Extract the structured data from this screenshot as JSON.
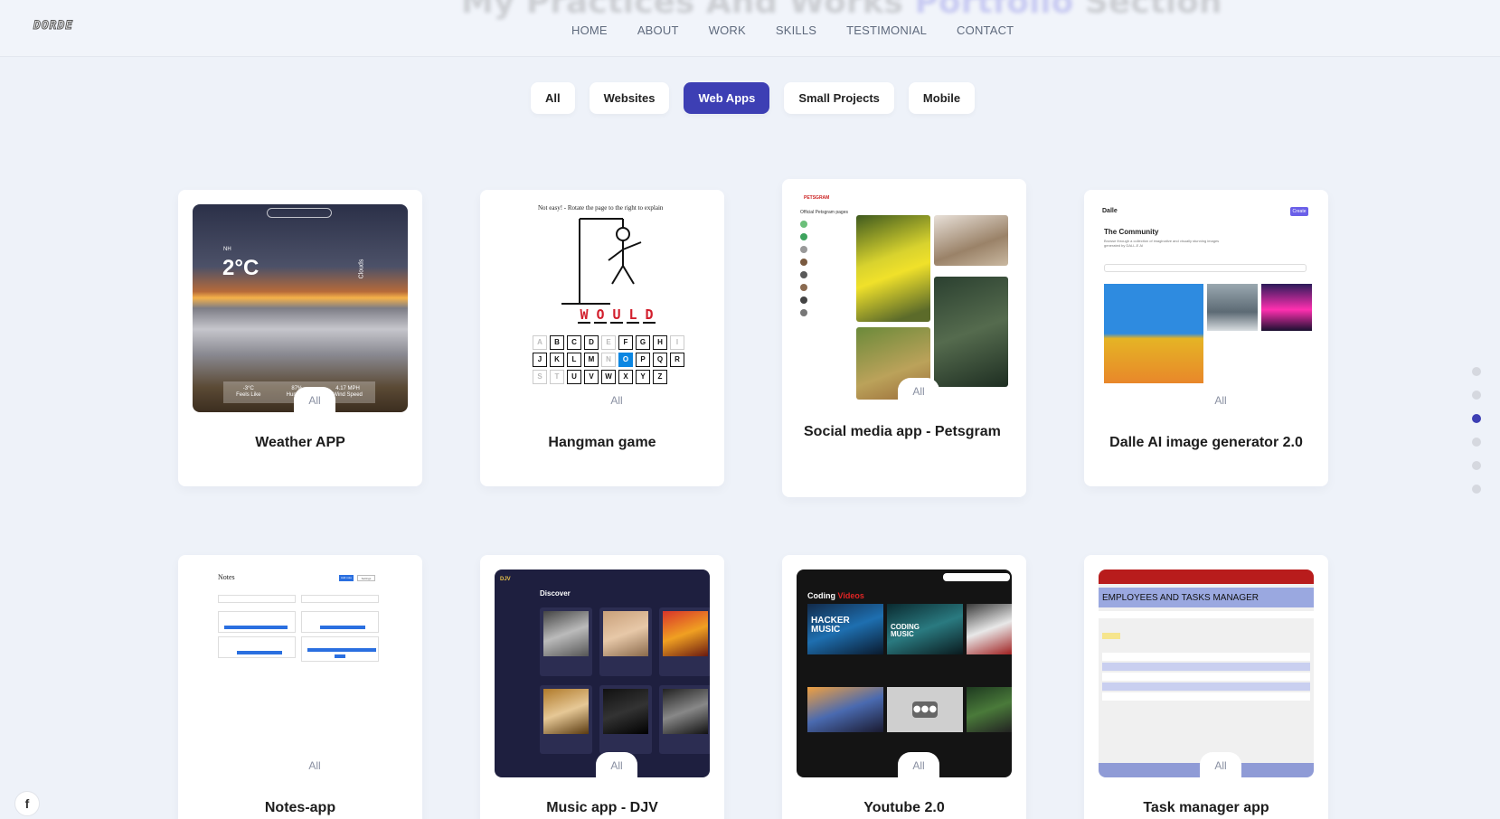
{
  "header": {
    "logo": "DORDE",
    "ghost_prefix": "My Practices And Works ",
    "ghost_accent": "Portfolio",
    "ghost_suffix": " Section",
    "nav": [
      "HOME",
      "ABOUT",
      "WORK",
      "SKILLS",
      "TESTIMONIAL",
      "CONTACT"
    ]
  },
  "filters": [
    {
      "label": "All",
      "active": false
    },
    {
      "label": "Websites",
      "active": false
    },
    {
      "label": "Web Apps",
      "active": true
    },
    {
      "label": "Small Projects",
      "active": false
    },
    {
      "label": "Mobile",
      "active": false
    }
  ],
  "projects": [
    {
      "title": "Weather APP",
      "tag": "All"
    },
    {
      "title": "Hangman game",
      "tag": "All"
    },
    {
      "title": "Social media app - Petsgram",
      "tag": "All"
    },
    {
      "title": "Dalle AI image generator 2.0",
      "tag": "All"
    },
    {
      "title": "Notes-app",
      "tag": "All"
    },
    {
      "title": "Music app - DJV",
      "tag": "All"
    },
    {
      "title": "Youtube 2.0",
      "tag": "All"
    },
    {
      "title": "Task manager app",
      "tag": "All"
    }
  ],
  "weather": {
    "city": "NH",
    "temp": "2°C",
    "condition": "Clouds",
    "feels_value": "-3°C",
    "feels_label": "Feels Like",
    "humidity_value": "87%",
    "humidity_label": "Humidity",
    "wind_value": "4.17 MPH",
    "wind_label": "Wind Speed"
  },
  "hangman": {
    "hint": "Not easy! - Rotate the page to the right to explain",
    "word": [
      "W",
      "O",
      "U",
      "L",
      "D"
    ],
    "rows": [
      [
        "A",
        "B",
        "C",
        "D",
        "E",
        "F",
        "G",
        "H",
        "I"
      ],
      [
        "J",
        "K",
        "L",
        "M",
        "N",
        "O",
        "P",
        "Q",
        "R"
      ],
      [
        "S",
        "T",
        "U",
        "V",
        "W",
        "X",
        "Y",
        "Z"
      ]
    ]
  },
  "petsgram": {
    "brand": "PETSGRAM",
    "heading": "Official Petsgram pages"
  },
  "dalle": {
    "brand": "Dalle",
    "heading": "The Community",
    "subtitle": "Browse through a collection of imaginative and visually stunning images generated by DALL-E AI",
    "create_label": "Create"
  },
  "notes": {
    "title": "Notes",
    "btn1": "Add note",
    "btn2": "Settings"
  },
  "djv": {
    "brand": "DJV",
    "heading": "Discover"
  },
  "yt": {
    "heading_a": "Coding ",
    "heading_b": "Videos",
    "tile1": "HACKER MUSIC",
    "tile2": "CODING MUSIC"
  },
  "task": {
    "heading": "EMPLOYEES AND TASKS MANAGER"
  },
  "social": {
    "facebook": "f"
  },
  "colors": {
    "accent": "#3d3fb4",
    "hangman_red": "#d21e2c",
    "hangman_blue": "#0b86e2"
  }
}
